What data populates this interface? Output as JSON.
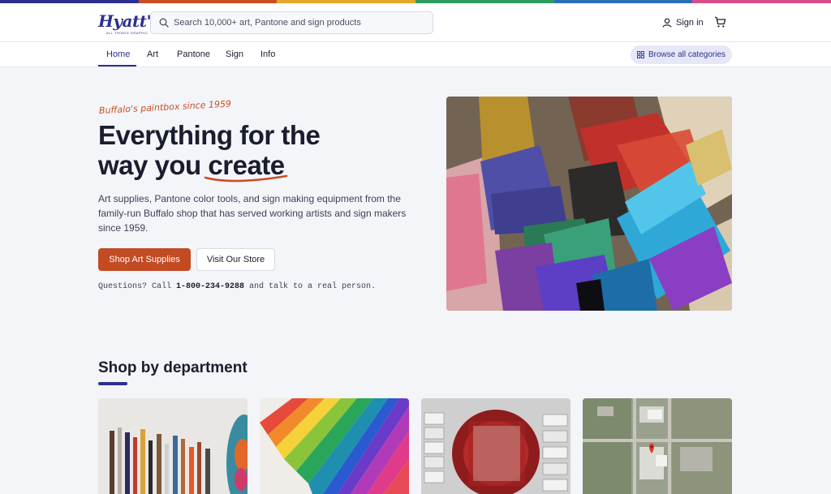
{
  "brand": {
    "logo_text": "Hyatt's",
    "logo_subtext": "ALL THINGS GRAPHIC",
    "rainbow_colors": [
      "#2c2f8f",
      "#c94f22",
      "#e6a72d",
      "#2e9a5f",
      "#2b6fb8",
      "#d94d8a"
    ]
  },
  "header": {
    "search_placeholder": "Search 10,000+ art, Pantone and sign products",
    "search_icon": "search-icon",
    "signin_label": "Sign in",
    "signin_icon": "user-icon",
    "cart_icon": "cart-icon"
  },
  "nav": {
    "items": [
      {
        "label": "Home",
        "active": true
      },
      {
        "label": "Art",
        "active": false
      },
      {
        "label": "Pantone",
        "active": false
      },
      {
        "label": "Sign",
        "active": false
      },
      {
        "label": "Info",
        "active": false
      }
    ],
    "browse_label": "Browse all categories",
    "browse_icon": "grid-icon"
  },
  "hero": {
    "tagline": "Buffalo's paintbox since 1959",
    "headline_line1": "Everything for the",
    "headline_line2_prefix": "way you ",
    "headline_highlight": "create",
    "description": "Art supplies, Pantone color tools, and sign making equipment from the family-run Buffalo shop that has served working artists and sign makers since 1959.",
    "primary_button": "Shop Art Supplies",
    "secondary_button": "Visit Our Store",
    "phone_prefix": "Questions? Call ",
    "phone_number": "1-800-234-9288",
    "phone_suffix": " and talk to a real person."
  },
  "departments": {
    "title": "Shop by department",
    "cards": [
      "paint-brushes-image",
      "pantone-swatches-image",
      "you-are-here-sign-image",
      "store-map-image"
    ]
  },
  "colors": {
    "accent": "#2c2f8f",
    "primary_button": "#c24b23",
    "tagline": "#c94f22"
  }
}
